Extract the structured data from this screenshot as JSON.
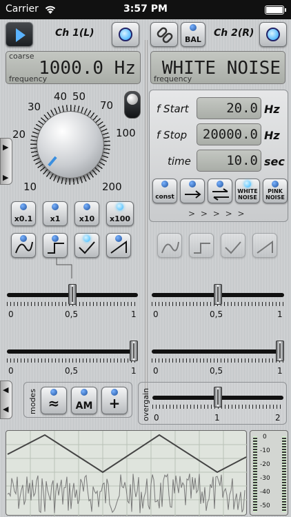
{
  "status": {
    "carrier": "Carrier",
    "time": "3:57 PM"
  },
  "ch1": {
    "label": "Ch 1(L)",
    "lcd_top": "coarse",
    "lcd_value": "1000.0 Hz",
    "lcd_bottom": "frequency",
    "knob_scale": [
      "10",
      "20",
      "30",
      "40",
      "50",
      "70",
      "100",
      "200"
    ],
    "multipliers": [
      "x0.1",
      "x1",
      "x10",
      "x100"
    ],
    "slider1": {
      "value": 0.5,
      "scale": [
        "0",
        "0,5",
        "1"
      ]
    },
    "slider2": {
      "value": 1.0,
      "scale": [
        "0",
        "0,5",
        "1"
      ]
    }
  },
  "ch2": {
    "label": "Ch 2(R)",
    "bal": "BAL",
    "lcd_value": "WHITE NOISE",
    "lcd_bottom": "frequency",
    "sweep": {
      "start_label": "f Start",
      "start_value": "20.0",
      "start_unit": "Hz",
      "stop_label": "f Stop",
      "stop_value": "20000.0",
      "stop_unit": "Hz",
      "time_label": "time",
      "time_value": "10.0",
      "time_unit": "sec"
    },
    "sweep_buttons": [
      "const",
      "",
      "",
      "WHITE NOISE",
      "PINK NOISE"
    ],
    "arrows": "> > > > >",
    "slider1": {
      "value": 0.5,
      "scale": [
        "0",
        "0,5",
        "1"
      ]
    },
    "slider2": {
      "value": 1.0,
      "scale": [
        "0",
        "0,5",
        "1"
      ]
    }
  },
  "modes": {
    "label": "modes",
    "buttons": [
      "≈",
      "AM",
      "+"
    ]
  },
  "overgain": {
    "label": "overgain",
    "value": 1.0,
    "scale": [
      "0",
      "1",
      "2"
    ]
  },
  "meter_scale": [
    "0",
    "-10",
    "-20",
    "-30",
    "-40",
    "-50"
  ],
  "colors": {
    "led": "#36b6ff",
    "lcd": "#b6bab4"
  }
}
